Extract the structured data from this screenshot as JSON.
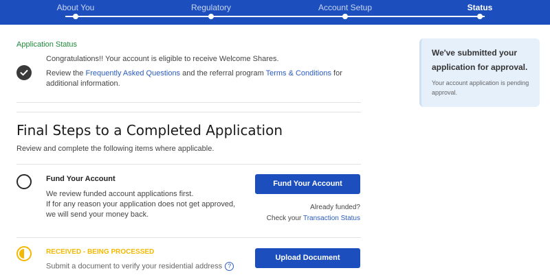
{
  "stepper": {
    "steps": [
      {
        "label": "About You"
      },
      {
        "label": "Regulatory"
      },
      {
        "label": "Account Setup"
      },
      {
        "label": "Status",
        "active": true
      }
    ]
  },
  "application_status": {
    "title": "Application Status",
    "congrats": "Congratulations!! Your account is eligible to receive Welcome Shares.",
    "review_prefix": "Review the ",
    "faq_link": "Frequently Asked Questions",
    "review_middle": " and the referral program ",
    "terms_link": "Terms & Conditions",
    "review_suffix": " for additional information."
  },
  "final_steps": {
    "title": "Final Steps to a Completed Application",
    "subtitle": "Review and complete the following items where applicable."
  },
  "fund_account": {
    "title": "Fund Your Account",
    "line1": "We review funded account applications first.",
    "line2": "If for any reason your application does not get approved, we will send your money back.",
    "button": "Fund Your Account",
    "already_funded": "Already funded?",
    "check_prefix": "Check your ",
    "transaction_link": "Transaction Status"
  },
  "upload_document": {
    "status": "RECEIVED - BEING PROCESSED",
    "description": "Submit a document to verify your residential address",
    "help_glyph": "?",
    "button": "Upload Document"
  },
  "side_panel": {
    "title": "We've submitted your application for approval.",
    "description": "Your account application is pending approval."
  },
  "colors": {
    "primary": "#1c4fbd",
    "success": "#1e8a3a",
    "pending": "#f5b800",
    "link": "#2a5bbf",
    "panel_bg": "#e6f0fb"
  },
  "icons": [
    "check-circle-icon",
    "empty-circle-icon",
    "half-circle-icon",
    "help-icon"
  ]
}
